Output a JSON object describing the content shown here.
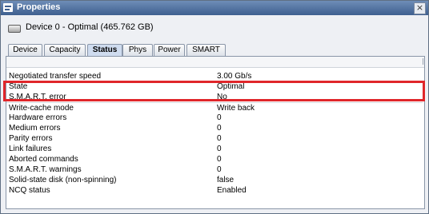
{
  "window": {
    "title": "Properties",
    "close_glyph": "×"
  },
  "device": {
    "label": "Device 0 - Optimal (465.762 GB)",
    "icon": "hard-disk-icon"
  },
  "tabs": [
    {
      "label": "Device",
      "active": false
    },
    {
      "label": "Capacity",
      "active": false
    },
    {
      "label": "Status",
      "active": true
    },
    {
      "label": "Phys",
      "active": false
    },
    {
      "label": "Power",
      "active": false
    },
    {
      "label": "SMART",
      "active": false
    }
  ],
  "rows": [
    {
      "label": "Negotiated transfer speed",
      "value": "3.00 Gb/s"
    },
    {
      "label": "State",
      "value": "Optimal"
    },
    {
      "label": "S.M.A.R.T. error",
      "value": "No"
    },
    {
      "label": "Write-cache mode",
      "value": "Write back"
    },
    {
      "label": "Hardware errors",
      "value": "0"
    },
    {
      "label": "Medium errors",
      "value": "0"
    },
    {
      "label": "Parity errors",
      "value": "0"
    },
    {
      "label": "Link failures",
      "value": "0"
    },
    {
      "label": "Aborted commands",
      "value": "0"
    },
    {
      "label": "S.M.A.R.T. warnings",
      "value": "0"
    },
    {
      "label": "Solid-state disk (non-spinning)",
      "value": "false"
    },
    {
      "label": "NCQ status",
      "value": "Enabled"
    }
  ],
  "highlight_color": "#e0262a"
}
